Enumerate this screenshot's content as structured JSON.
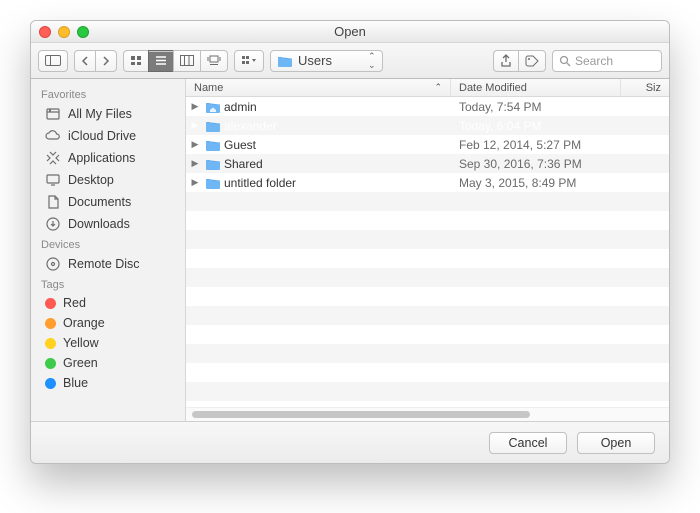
{
  "window": {
    "title": "Open"
  },
  "toolbar": {
    "location_icon": "users-folder",
    "location_label": "Users",
    "search_placeholder": "Search"
  },
  "columns": {
    "name": "Name",
    "date": "Date Modified",
    "size": "Siz"
  },
  "sidebar": {
    "groups": [
      {
        "label": "Favorites",
        "items": [
          {
            "icon": "all-my-files-icon",
            "label": "All My Files"
          },
          {
            "icon": "icloud-icon",
            "label": "iCloud Drive"
          },
          {
            "icon": "applications-icon",
            "label": "Applications"
          },
          {
            "icon": "desktop-icon",
            "label": "Desktop"
          },
          {
            "icon": "documents-icon",
            "label": "Documents"
          },
          {
            "icon": "downloads-icon",
            "label": "Downloads"
          }
        ]
      },
      {
        "label": "Devices",
        "items": [
          {
            "icon": "remote-disc-icon",
            "label": "Remote Disc"
          }
        ]
      },
      {
        "label": "Tags",
        "items": [
          {
            "icon": "tag-dot",
            "color": "#ff5a52",
            "label": "Red"
          },
          {
            "icon": "tag-dot",
            "color": "#ff9e2c",
            "label": "Orange"
          },
          {
            "icon": "tag-dot",
            "color": "#ffd21f",
            "label": "Yellow"
          },
          {
            "icon": "tag-dot",
            "color": "#3ecb4c",
            "label": "Green"
          },
          {
            "icon": "tag-dot",
            "color": "#1e90ff",
            "label": "Blue"
          }
        ]
      }
    ]
  },
  "rows": [
    {
      "icon": "home-folder",
      "name": "admin",
      "date": "Today, 7:54 PM",
      "selected": false
    },
    {
      "icon": "folder",
      "name": "alexander",
      "date": "Today, 6:04 PM",
      "selected": true
    },
    {
      "icon": "folder",
      "name": "Guest",
      "date": "Feb 12, 2014, 5:27 PM",
      "selected": false
    },
    {
      "icon": "folder",
      "name": "Shared",
      "date": "Sep 30, 2016, 7:36 PM",
      "selected": false
    },
    {
      "icon": "folder",
      "name": "untitled folder",
      "date": "May 3, 2015, 8:49 PM",
      "selected": false
    }
  ],
  "empty_stripes": 14,
  "footer": {
    "cancel": "Cancel",
    "open": "Open"
  },
  "colors": {
    "selection": "#1a6fe0",
    "folder": "#6fb6f4"
  }
}
